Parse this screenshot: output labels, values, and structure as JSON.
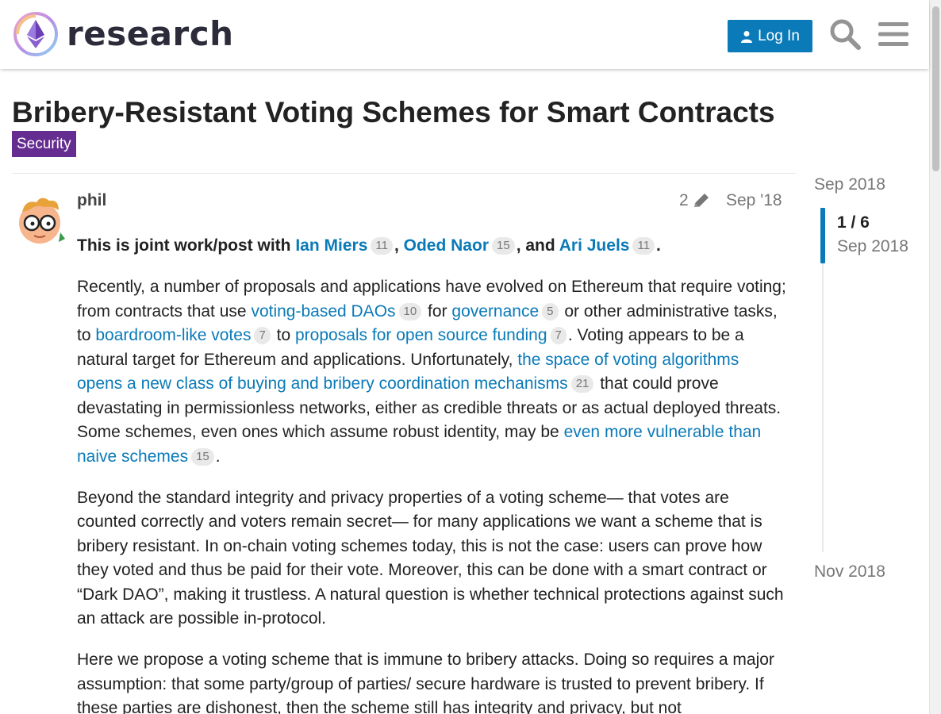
{
  "header": {
    "site_name": "research",
    "login_label": "Log In"
  },
  "topic": {
    "title": "Bribery-Resistant Voting Schemes for Smart Contracts",
    "category": "Security"
  },
  "post": {
    "username": "phil",
    "edit_count": "2",
    "date": "Sep '18",
    "p1": {
      "t1": "This is joint work/post with ",
      "a1": "Ian Miers",
      "c1": "11",
      "t2": ", ",
      "a2": "Oded Naor",
      "c2": "15",
      "t3": ", and ",
      "a3": "Ari Juels",
      "c3": "11",
      "t4": "."
    },
    "p2": {
      "t1": "Recently, a number of proposals and applications have evolved on Ethereum that require voting; from contracts that use ",
      "a1": "voting-based DAOs",
      "c1": "10",
      "t2": " for ",
      "a2": "governance",
      "c2": "5",
      "t3": " or other administrative tasks, to ",
      "a3": "boardroom-like votes",
      "c3": "7",
      "t4": " to ",
      "a4": "proposals for open source funding",
      "c4": "7",
      "t5": ". Voting appears to be a natural target for Ethereum and applications. Unfortunately, ",
      "a5": "the space of voting algorithms opens a new class of buying and bribery coordination mechanisms",
      "c5": "21",
      "t6": " that could prove devastating in permissionless networks, either as credible threats or as actual deployed threats. Some schemes, even ones which assume robust identity, may be ",
      "a6": "even more vulnerable than naive schemes",
      "c6": "15",
      "t7": "."
    },
    "p3": "Beyond the standard integrity and privacy properties of a voting scheme— that votes are counted correctly and voters remain secret— for many applications we want a scheme that is bribery resistant. In on-chain voting schemes today, this is not the case: users can prove how they voted and thus be paid for their vote. Moreover, this can be done with a smart contract or “Dark DAO”, making it trustless. A natural question is whether technical protections against such an attack are possible in-protocol.",
    "p4": "Here we propose a voting scheme that is immune to bribery attacks. Doing so requires a major assumption: that some party/group of parties/ secure hardware is trusted to prevent bribery. If these parties are dishonest, then the scheme still has integrity and privacy, but not"
  },
  "timeline": {
    "start": "Sep 2018",
    "position": "1 / 6",
    "position_date": "Sep 2018",
    "end": "Nov 2018"
  },
  "colors": {
    "link": "#0a7ab8",
    "category": "#652d90",
    "button": "#0a7ab8"
  }
}
